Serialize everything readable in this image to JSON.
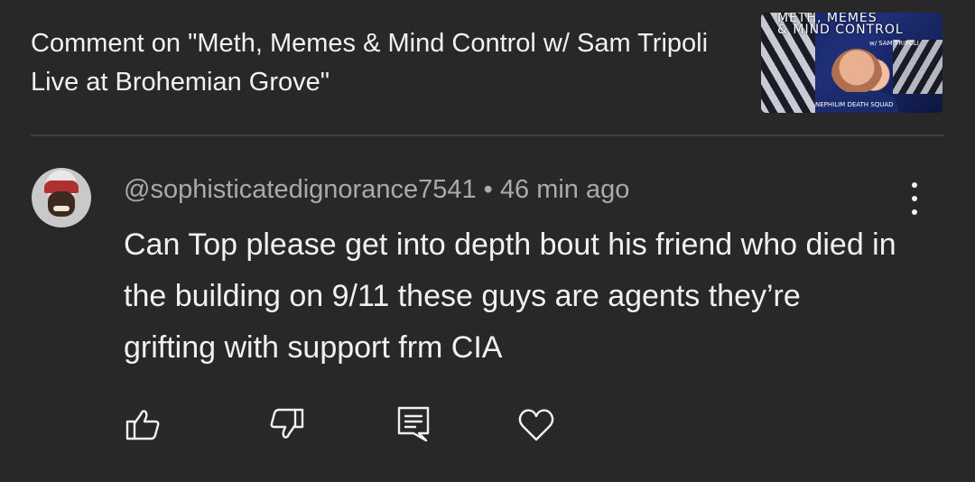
{
  "header": {
    "title": "Comment on \"Meth, Memes & Mind Control w/ Sam Tripoli Live at Brohemian Grove\"",
    "thumbnail": {
      "title_line1": "METH, MEMES",
      "title_line2": "& MIND CONTROL",
      "subtitle": "w/ SAM TRIPOLI",
      "footer": "NEPHILIM DEATH SQUAD"
    }
  },
  "comment": {
    "author": "@sophisticatedignorance7541",
    "separator": " • ",
    "time": "46 min ago",
    "text": "Can Top please get into depth bout his friend who died in  the building on 9/11 these guys are agents they’re grifting with support frm CIA"
  },
  "actions": [
    {
      "name": "like",
      "icon": "thumbs-up-icon"
    },
    {
      "name": "dislike",
      "icon": "thumbs-down-icon"
    },
    {
      "name": "reply",
      "icon": "comment-icon"
    },
    {
      "name": "heart",
      "icon": "heart-icon"
    }
  ],
  "colors": {
    "background": "#282828",
    "text_primary": "#f1f1f1",
    "text_secondary": "#aaaaaa",
    "divider": "#3f3f3f"
  }
}
